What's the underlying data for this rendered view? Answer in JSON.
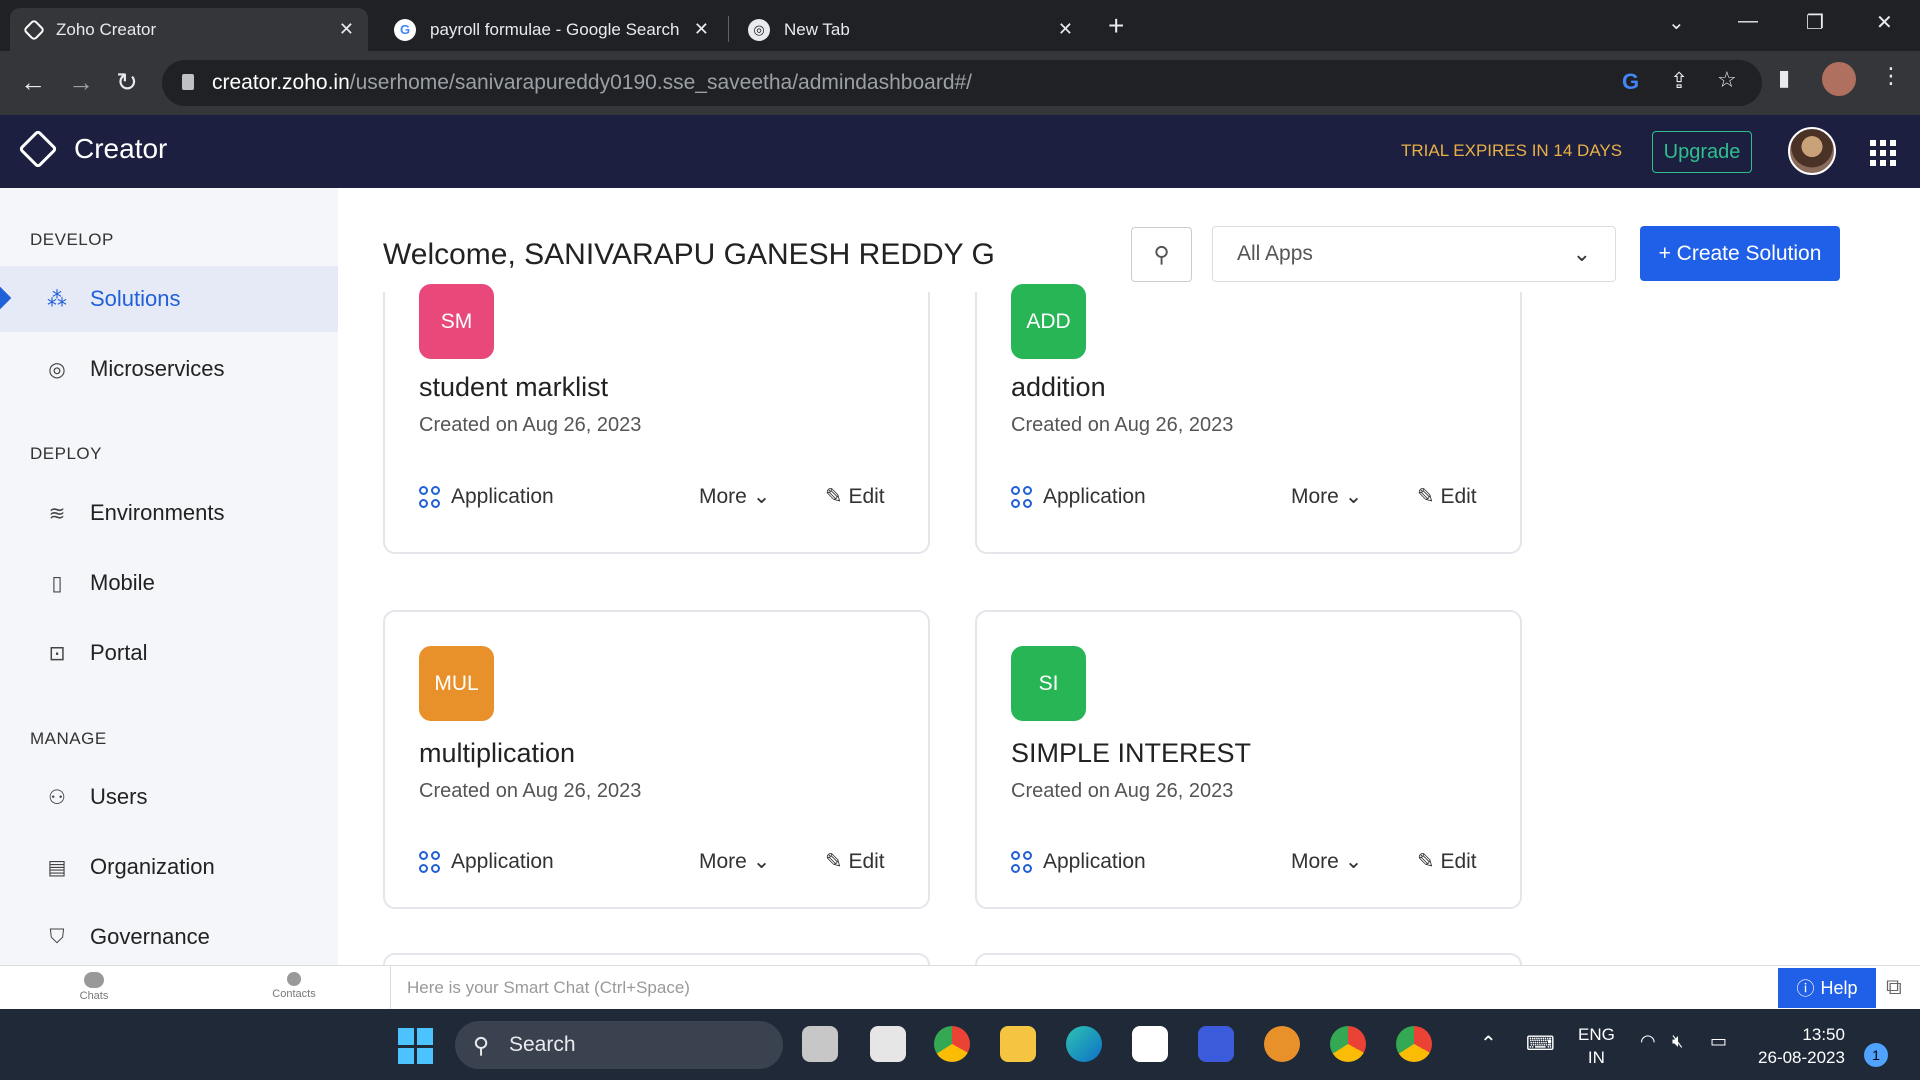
{
  "browser": {
    "tabs": [
      {
        "title": "Zoho Creator"
      },
      {
        "title": "payroll formulae - Google Search"
      },
      {
        "title": "New Tab"
      }
    ],
    "url_host": "creator.zoho.in",
    "url_path": "/userhome/sanivarapureddy0190.sse_saveetha/admindashboard#/"
  },
  "header": {
    "app_name": "Creator",
    "trial_text": "TRIAL EXPIRES IN 14 DAYS",
    "upgrade_label": "Upgrade"
  },
  "sidebar": {
    "sections": [
      {
        "label": "DEVELOP"
      },
      {
        "label": "DEPLOY"
      },
      {
        "label": "MANAGE"
      }
    ],
    "items": [
      {
        "label": "Solutions",
        "icon": "solutions-icon"
      },
      {
        "label": "Microservices",
        "icon": "microservices-icon"
      },
      {
        "label": "Environments",
        "icon": "layers-icon"
      },
      {
        "label": "Mobile",
        "icon": "mobile-icon"
      },
      {
        "label": "Portal",
        "icon": "portal-icon"
      },
      {
        "label": "Users",
        "icon": "users-icon"
      },
      {
        "label": "Organization",
        "icon": "building-icon"
      },
      {
        "label": "Governance",
        "icon": "shield-icon"
      }
    ]
  },
  "main": {
    "welcome": "Welcome, SANIVARAPU GANESH REDDY G",
    "filter_selected": "All Apps",
    "create_label": "+ Create Solution"
  },
  "cards": [
    {
      "badge": "SM",
      "color": "#e8487a",
      "title": "student marklist",
      "date": "Created on Aug 26, 2023",
      "type": "Application",
      "more": "More",
      "edit": "Edit"
    },
    {
      "badge": "ADD",
      "color": "#27b556",
      "title": "addition",
      "date": "Created on Aug 26, 2023",
      "type": "Application",
      "more": "More",
      "edit": "Edit"
    },
    {
      "badge": "MUL",
      "color": "#e8902a",
      "title": "multiplication",
      "date": "Created on Aug 26, 2023",
      "type": "Application",
      "more": "More",
      "edit": "Edit"
    },
    {
      "badge": "SI",
      "color": "#27b556",
      "title": "SIMPLE INTEREST",
      "date": "Created on Aug 26, 2023",
      "type": "Application",
      "more": "More",
      "edit": "Edit"
    }
  ],
  "chatbar": {
    "chats_label": "Chats",
    "contacts_label": "Contacts",
    "smart_chat_placeholder": "Here is your Smart Chat (Ctrl+Space)",
    "help_label": "Help"
  },
  "taskbar": {
    "search_label": "Search",
    "lang_line1": "ENG",
    "lang_line2": "IN",
    "time": "13:50",
    "date": "26-08-2023",
    "notification_count": "1"
  }
}
